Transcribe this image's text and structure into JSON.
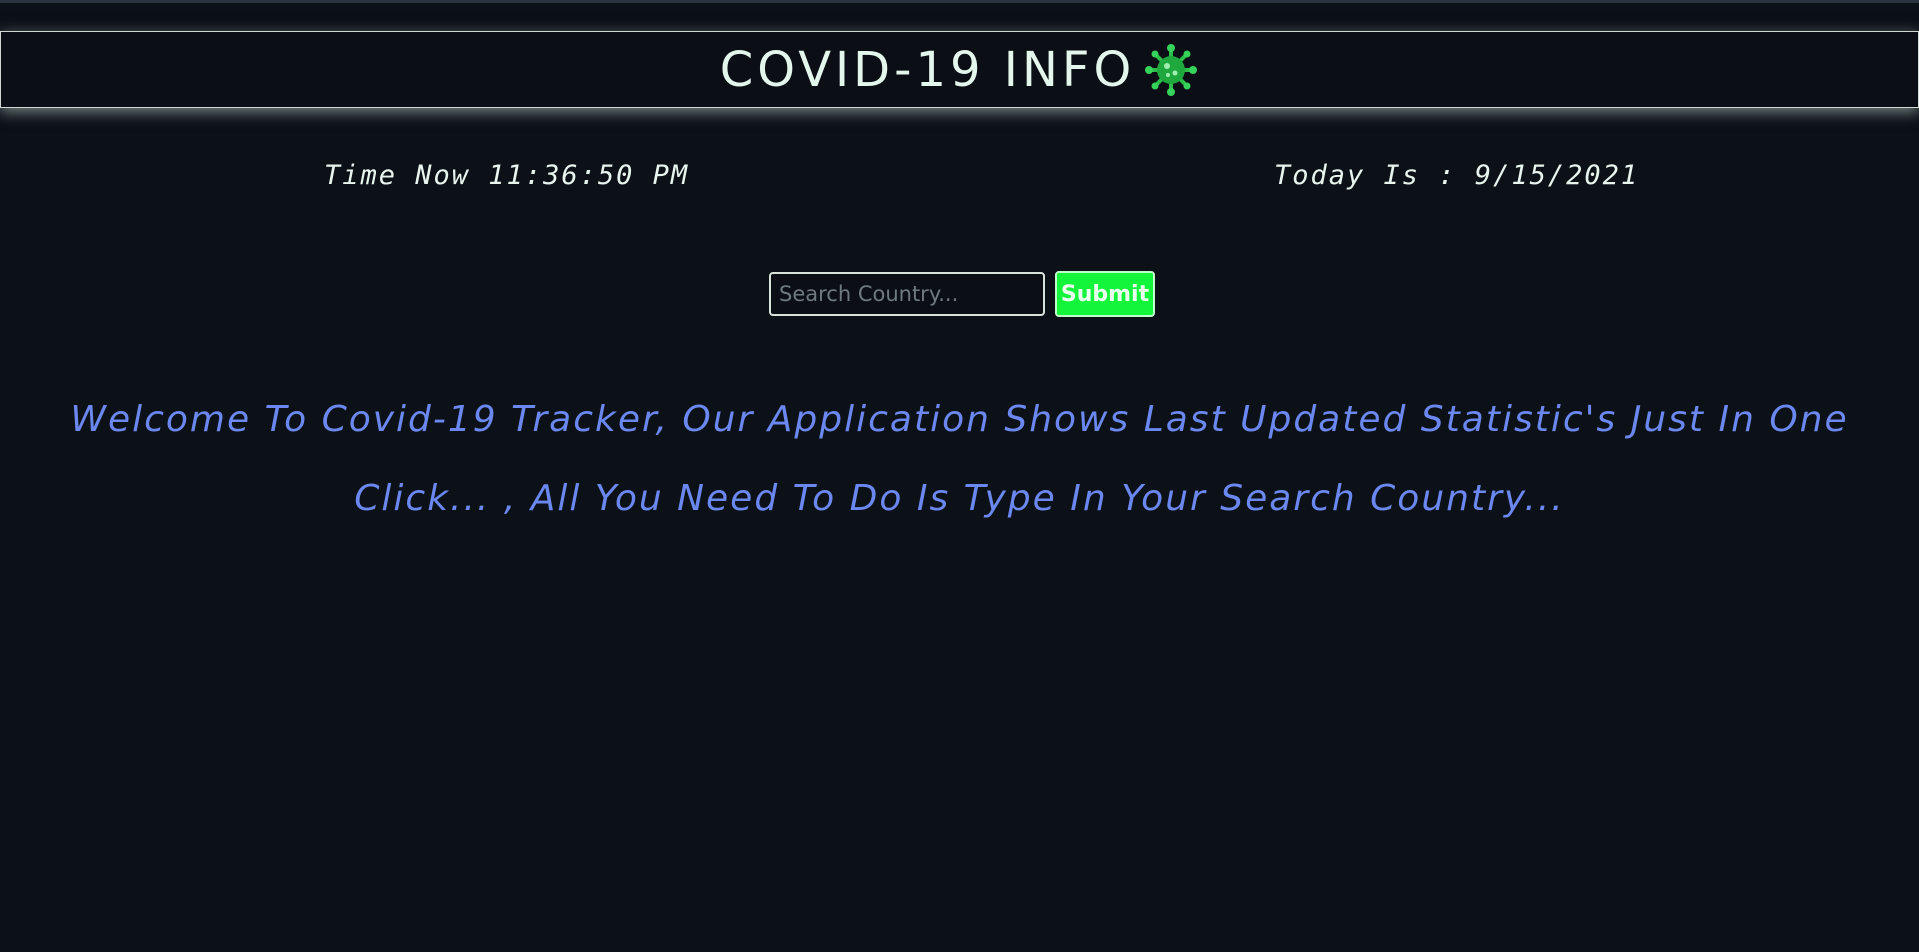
{
  "header": {
    "title": "COVID-19 INFO",
    "icon": "virus-icon"
  },
  "clock": {
    "time_text": "Time Now 11:36:50 PM",
    "date_text": "Today Is : 9/15/2021"
  },
  "search": {
    "placeholder": "Search Country...",
    "value": "",
    "submit_label": "Submit"
  },
  "welcome": {
    "message": "Welcome To Covid-19 Tracker, Our Application Shows Last Updated Statistic's Just In One Click... , All You Need To Do Is Type In Your Search Country..."
  },
  "colors": {
    "background": "#0c1017",
    "accent_green": "#12f53a",
    "message_blue": "#6b88f0",
    "text_light": "#e4f7ec"
  }
}
